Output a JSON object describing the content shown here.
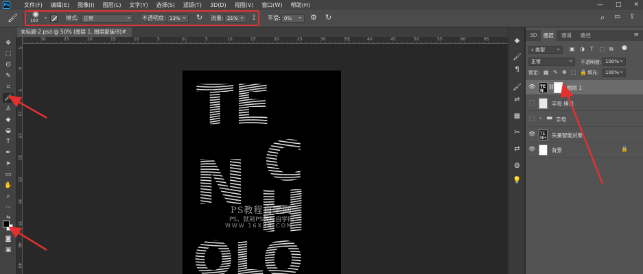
{
  "menu": [
    "文件(F)",
    "编辑(E)",
    "图像(I)",
    "图层(L)",
    "文字(Y)",
    "选择(S)",
    "滤镜(T)",
    "3D(D)",
    "视图(V)",
    "窗口(W)",
    "帮助(H)"
  ],
  "app_logo": "Ps",
  "window_controls": {
    "minimize": "—",
    "maximize": "□",
    "close": "✕"
  },
  "options": {
    "brush_size": "100",
    "mode_label": "模式:",
    "mode_value": "正常",
    "opacity_label": "不透明度:",
    "opacity_value": "13%",
    "flow_label": "流量:",
    "flow_value": "21%",
    "smoothing_label": "平滑:",
    "smoothing_value": "0%"
  },
  "document_tab": {
    "title": "未标题-2.psd @ 50% (图层 1, 图层蒙版/8) *",
    "close": "×"
  },
  "ruler_h": [
    "30",
    "25",
    "20",
    "15",
    "10",
    "5",
    "0",
    "5",
    "10",
    "15",
    "20",
    "25",
    "30",
    "35",
    "40",
    "45",
    "50",
    "55",
    "60",
    "65"
  ],
  "ruler_v": [
    "5",
    "0",
    "5",
    "10",
    "15",
    "20",
    "25",
    "30",
    "35",
    "40",
    "45"
  ],
  "watermark": {
    "line1": "PS教程自学网",
    "line2": "PS，就到PS教程自学网",
    "line3": "WWW.16XX8.COM"
  },
  "panel": {
    "tabs": [
      "3D",
      "图层",
      "通道",
      "路径"
    ],
    "active_tab": "图层",
    "filter_value": "类型",
    "blend_value": "正常",
    "opacity_label": "不透明度:",
    "opacity_value": "100%",
    "lock_label": "锁定:",
    "fill_label": "填充:",
    "fill_value": "100%",
    "layers": [
      {
        "name": "图层 1",
        "visible": true,
        "selected": true
      },
      {
        "name": "字母 拷贝",
        "visible": false,
        "selected": false
      },
      {
        "name": "字母",
        "visible": false,
        "selected": false
      },
      {
        "name": "矢量智能对象",
        "visible": true,
        "selected": false
      },
      {
        "name": "背景",
        "visible": true,
        "selected": false
      }
    ]
  },
  "colors": {
    "highlight": "#e53030",
    "foreground": "#000000",
    "background": "#ffffff"
  }
}
